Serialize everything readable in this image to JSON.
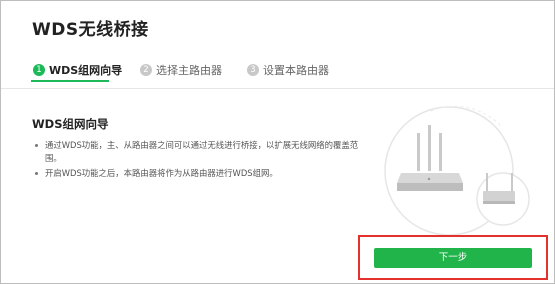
{
  "page": {
    "title": "WDS无线桥接"
  },
  "steps": [
    {
      "number": "1",
      "label": "WDS组网向导",
      "state": "active"
    },
    {
      "number": "2",
      "label": "选择主路由器",
      "state": "inactive"
    },
    {
      "number": "3",
      "label": "设置本路由器",
      "state": "inactive"
    }
  ],
  "content": {
    "section_title": "WDS组网向导",
    "bullets": [
      "通过WDS功能，主、从路由器之间可以通过无线进行桥接，以扩展无线网络的覆盖范围。",
      "开启WDS功能之后，本路由器将作为从路由器进行WDS组网。"
    ]
  },
  "illustration": {
    "icon": "router-bridge-icon"
  },
  "actions": {
    "next_label": "下一步"
  },
  "colors": {
    "accent": "#1db857",
    "button": "#21b44b",
    "highlight": "#e5312b"
  }
}
